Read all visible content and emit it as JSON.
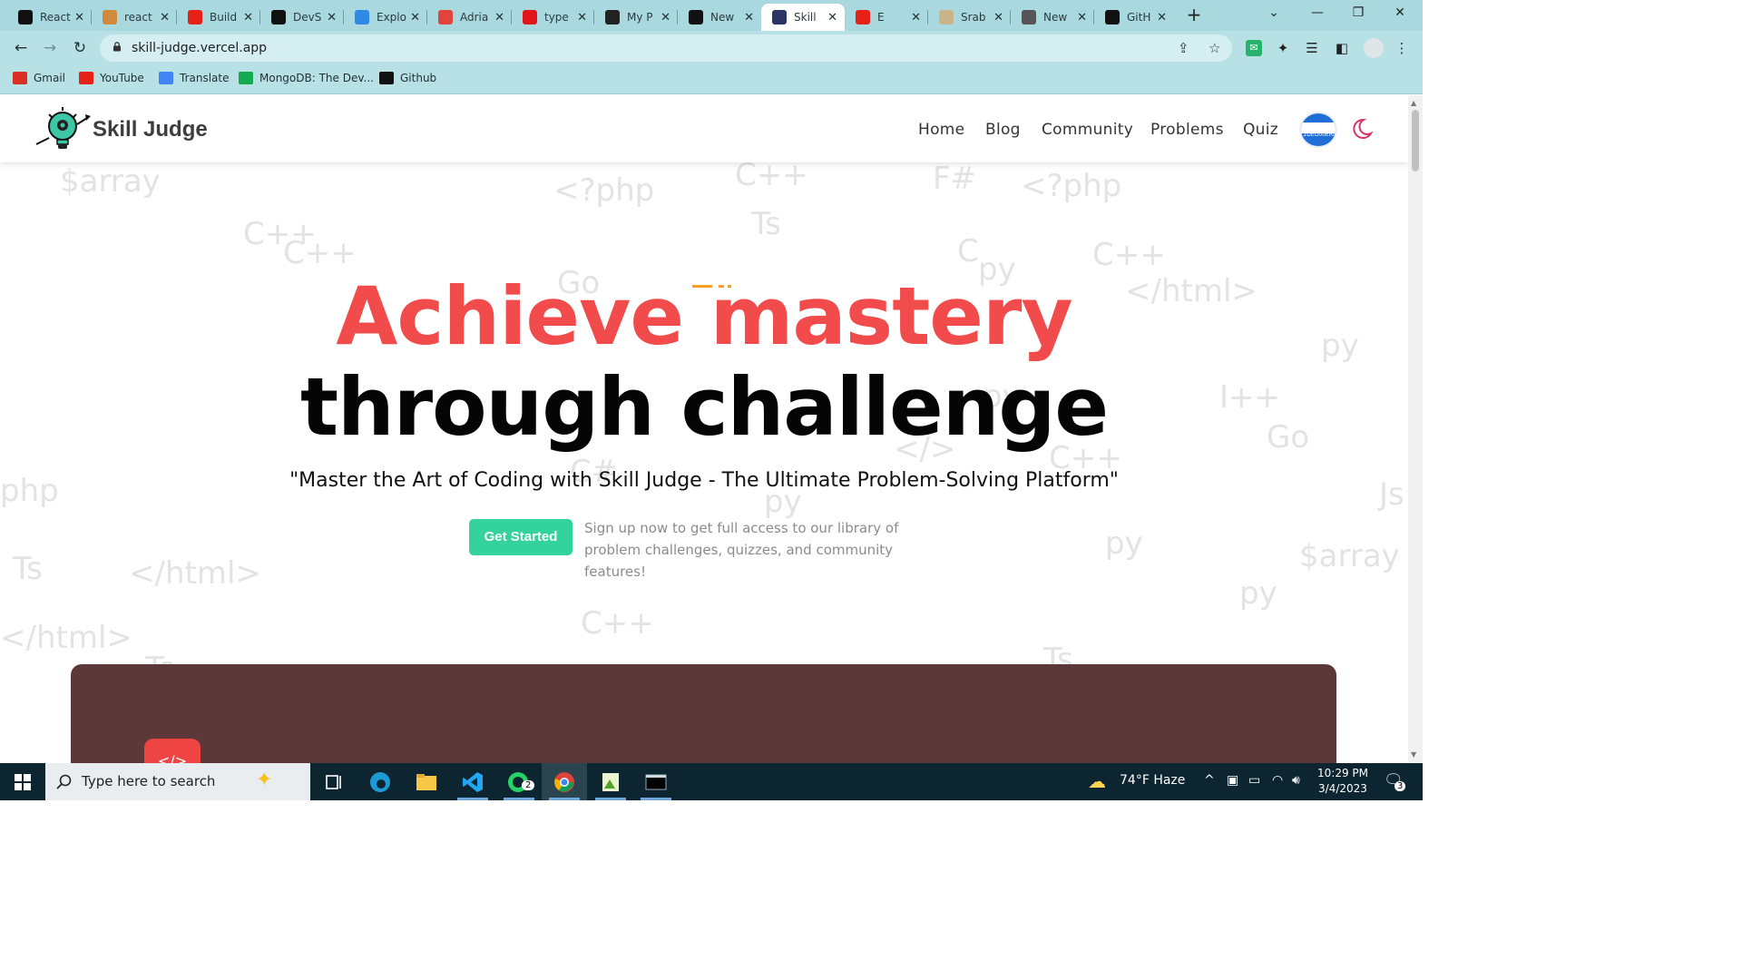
{
  "browser": {
    "tabs": [
      {
        "title": "React",
        "icon": "github-icon",
        "color": "#111111"
      },
      {
        "title": "react",
        "icon": "stack-icon",
        "color": "#d08a3c"
      },
      {
        "title": "Build",
        "icon": "youtube-icon",
        "color": "#e62117"
      },
      {
        "title": "DevS",
        "icon": "github-icon",
        "color": "#111111"
      },
      {
        "title": "Explo",
        "icon": "cube-icon",
        "color": "#2f8ae6"
      },
      {
        "title": "Adria",
        "icon": "a-icon",
        "color": "#e2433c"
      },
      {
        "title": "type",
        "icon": "n-icon",
        "color": "#e0161b"
      },
      {
        "title": "My P",
        "icon": "react-icon",
        "color": "#222222"
      },
      {
        "title": "New",
        "icon": "triangle-icon",
        "color": "#111111"
      },
      {
        "title": "Skill",
        "icon": "skill-icon",
        "color": "#2a3566"
      },
      {
        "title": "E",
        "icon": "youtube-icon",
        "color": "#e62117"
      },
      {
        "title": "Srab",
        "icon": "loading-icon",
        "color": "#c9b38a"
      },
      {
        "title": "New",
        "icon": "chrome-icon",
        "color": "#555555"
      },
      {
        "title": "GitH",
        "icon": "github-icon",
        "color": "#111111"
      }
    ],
    "active_tab_index": 9,
    "url": "skill-judge.vercel.app",
    "bookmarks": [
      {
        "label": "Gmail",
        "icon": "gmail-icon",
        "color": "#d93025"
      },
      {
        "label": "YouTube",
        "icon": "youtube-icon",
        "color": "#e62117"
      },
      {
        "label": "Translate",
        "icon": "translate-icon",
        "color": "#4285f4"
      },
      {
        "label": "MongoDB: The Dev...",
        "icon": "mongodb-icon",
        "color": "#13aa52"
      },
      {
        "label": "Github",
        "icon": "github-icon",
        "color": "#111111"
      }
    ]
  },
  "site": {
    "brand": "Skill Judge",
    "nav": [
      "Home",
      "Blog",
      "Community",
      "Problems",
      "Quiz"
    ],
    "avatar_text": "2DEO00ERN",
    "hero_line1": "Achieve mastery",
    "hero_line2": "through challenge",
    "tagline": "\"Master the Art of Coding with Skill Judge - The Ultimate Problem-Solving Platform\"",
    "cta_label": "Get Started",
    "cta_note": "Sign up now to get full access to our library of problem challenges, quizzes, and community features!",
    "accent_color": "#f24b4b",
    "cta_color": "#34d39e",
    "card_color": "#5c3838"
  },
  "background_words": [
    "$array",
    "<?php",
    "C++",
    "Ts",
    "F#",
    "<?php",
    "C++",
    "C++",
    "C",
    "py",
    "C++",
    "Go",
    "</html>",
    "py",
    "py",
    "Go",
    "</>",
    "C++",
    "C#",
    "py",
    "php",
    "Js",
    "Ts",
    "</html>",
    "py",
    "$array",
    "py",
    "</html>",
    "C++",
    "Ts",
    "Ts",
    "I++"
  ],
  "taskbar": {
    "search_placeholder": "Type here to search",
    "weather": "74°F  Haze",
    "time": "10:29 PM",
    "date": "3/4/2023",
    "whatsapp_badge": "2",
    "notification_count": "3"
  }
}
